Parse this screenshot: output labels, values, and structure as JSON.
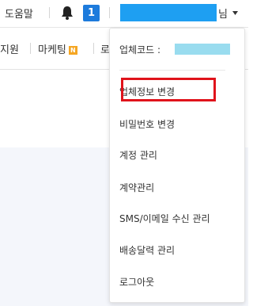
{
  "header": {
    "help_label": "도움말",
    "notification_count": "1",
    "user_suffix": "님",
    "user_name_redaction_color": "#1e9ff2"
  },
  "nav": {
    "items": [
      {
        "label": "지원"
      },
      {
        "label": "마케팅",
        "badge": "N"
      },
      {
        "label": "로"
      }
    ]
  },
  "menu": {
    "company_code_label": "업체코드 :",
    "company_code_redaction_color": "#99dcef",
    "items": [
      {
        "label": "업체정보 변경",
        "highlighted": true
      },
      {
        "label": "비밀번호 변경"
      },
      {
        "label": "계정 관리"
      },
      {
        "label": "계약관리"
      },
      {
        "label": "SMS/이메일 수신 관리"
      },
      {
        "label": "배송달력 관리"
      },
      {
        "label": "로그아웃"
      }
    ],
    "highlight_color": "#e0131b"
  }
}
